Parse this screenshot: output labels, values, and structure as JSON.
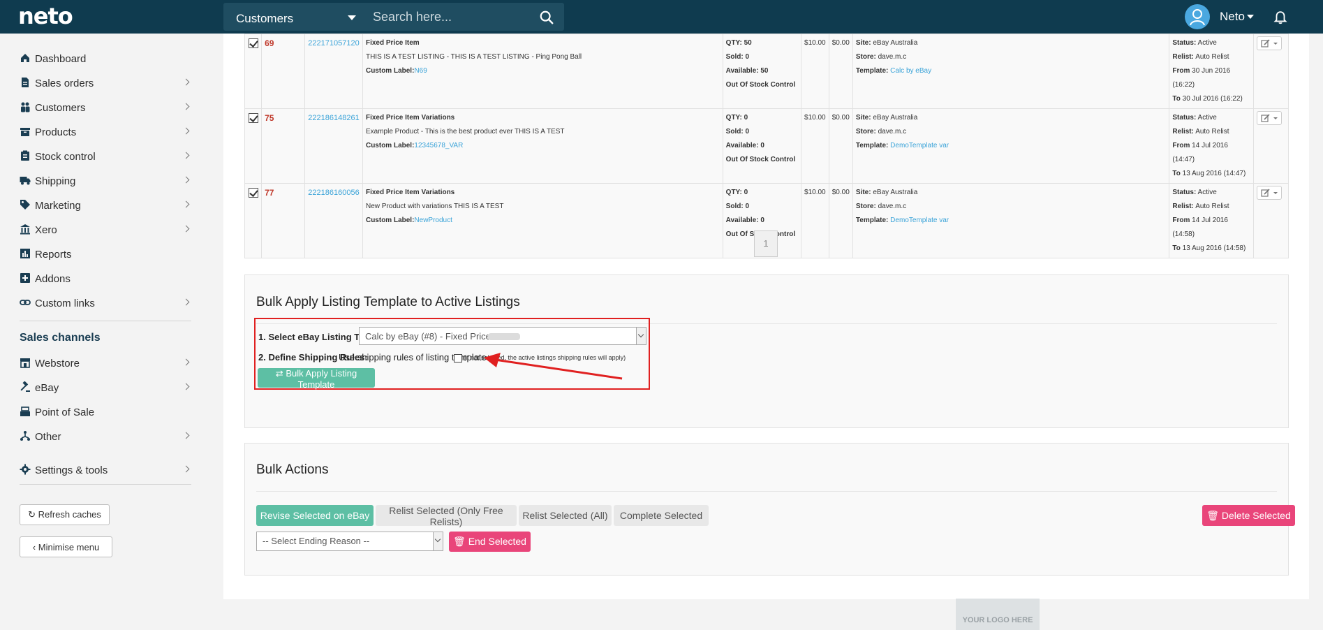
{
  "brand": {
    "logo": "neto",
    "primary_color": "#0f3b4f",
    "accent_teal": "#5dbfa4",
    "accent_pink": "#e9457a",
    "link_color": "#3aa3d8"
  },
  "header": {
    "search_scope": "Customers",
    "search_placeholder": "Search here...",
    "user_name": "Neto",
    "icons": [
      "search-icon",
      "user-avatar-icon",
      "bell-icon"
    ]
  },
  "sidebar": {
    "items": [
      {
        "label": "Dashboard",
        "icon": "home-icon"
      },
      {
        "label": "Sales orders",
        "icon": "document-icon"
      },
      {
        "label": "Customers",
        "icon": "people-icon"
      },
      {
        "label": "Products",
        "icon": "box-icon"
      },
      {
        "label": "Stock control",
        "icon": "clipboard-icon"
      },
      {
        "label": "Shipping",
        "icon": "truck-icon"
      },
      {
        "label": "Marketing",
        "icon": "tag-icon"
      },
      {
        "label": "Xero",
        "icon": "bank-icon"
      },
      {
        "label": "Reports",
        "icon": "bar-chart-icon"
      },
      {
        "label": "Addons",
        "icon": "plus-square-icon"
      },
      {
        "label": "Custom links",
        "icon": "link-icon"
      }
    ],
    "sales_channels_title": "Sales channels",
    "channels": [
      {
        "label": "Webstore",
        "icon": "store-icon"
      },
      {
        "label": "eBay",
        "icon": "gavel-icon"
      },
      {
        "label": "Point of Sale",
        "icon": "register-icon"
      },
      {
        "label": "Other",
        "icon": "network-icon"
      }
    ],
    "settings_label": "Settings & tools",
    "refresh_label": "Refresh caches",
    "minimise_label": "Minimise menu"
  },
  "listings": [
    {
      "id": "69",
      "item_no": "222171057120",
      "type": "Fixed Price Item",
      "title": "THIS IS A TEST LISTING - THIS IS A TEST LISTING - Ping Pong Ball",
      "custom_label_key": "Custom Label:",
      "custom_label": "N69",
      "qty": "QTY: 50",
      "sold": "Sold: 0",
      "available": "Available: 50",
      "oos": "Out Of Stock Control",
      "price": "$10.00",
      "shipping": "$0.00",
      "site_key": "Site:",
      "site": "eBay Australia",
      "store_key": "Store:",
      "store": "dave.m.c",
      "template_key": "Template:",
      "template": "Calc by eBay",
      "status_key": "Status:",
      "status": "Active",
      "relist_key": "Relist:",
      "relist": "Auto Relist",
      "from_key": "From",
      "from": "30 Jun 2016 (16:22)",
      "to_key": "To",
      "to": "30 Jul 2016 (16:22)"
    },
    {
      "id": "75",
      "item_no": "222186148261",
      "type": "Fixed Price Item Variations",
      "title": "Example Product - This is the best product ever THIS IS A TEST",
      "custom_label_key": "Custom Label:",
      "custom_label": "12345678_VAR",
      "qty": "QTY: 0",
      "sold": "Sold: 0",
      "available": "Available: 0",
      "oos": "Out Of Stock Control",
      "price": "$10.00",
      "shipping": "$0.00",
      "site_key": "Site:",
      "site": "eBay Australia",
      "store_key": "Store:",
      "store": "dave.m.c",
      "template_key": "Template:",
      "template": "DemoTemplate var",
      "status_key": "Status:",
      "status": "Active",
      "relist_key": "Relist:",
      "relist": "Auto Relist",
      "from_key": "From",
      "from": "14 Jul 2016 (14:47)",
      "to_key": "To",
      "to": "13 Aug 2016 (14:47)"
    },
    {
      "id": "77",
      "item_no": "222186160056",
      "type": "Fixed Price Item Variations",
      "title": "New Product with variations THIS IS A TEST",
      "custom_label_key": "Custom Label:",
      "custom_label": "NewProduct",
      "qty": "QTY: 0",
      "sold": "Sold: 0",
      "available": "Available: 0",
      "oos": "Out Of Stock Control",
      "price": "$10.00",
      "shipping": "$0.00",
      "site_key": "Site:",
      "site": "eBay Australia",
      "store_key": "Store:",
      "store": "dave.m.c",
      "template_key": "Template:",
      "template": "DemoTemplate var",
      "status_key": "Status:",
      "status": "Active",
      "relist_key": "Relist:",
      "relist": "Auto Relist",
      "from_key": "From",
      "from": "14 Jul 2016 (14:58)",
      "to_key": "To",
      "to": "13 Aug 2016 (14:58)"
    }
  ],
  "pager": {
    "current": "1"
  },
  "bulk_template": {
    "title": "Bulk Apply Listing Template to Active Listings",
    "step1_label": "1. Select eBay Listing Template:",
    "template_value": "Calc by eBay (#8) - Fixed Price Item -",
    "step2_label": "2. Define Shipping Rules:",
    "step2_text": "Use shipping rules of listing template",
    "step2_note": "(if not selected, the active listings shipping rules will apply)",
    "apply_button": "Bulk Apply Listing Template"
  },
  "bulk_actions": {
    "title": "Bulk Actions",
    "revise": "Revise Selected on eBay",
    "relist_free": "Relist Selected (Only Free Relists)",
    "relist_all": "Relist Selected (All)",
    "complete": "Complete Selected",
    "delete": "Delete Selected",
    "end_reason_placeholder": "-- Select Ending Reason --",
    "end": "End Selected"
  },
  "footer": {
    "logo_placeholder": "YOUR LOGO HERE"
  }
}
